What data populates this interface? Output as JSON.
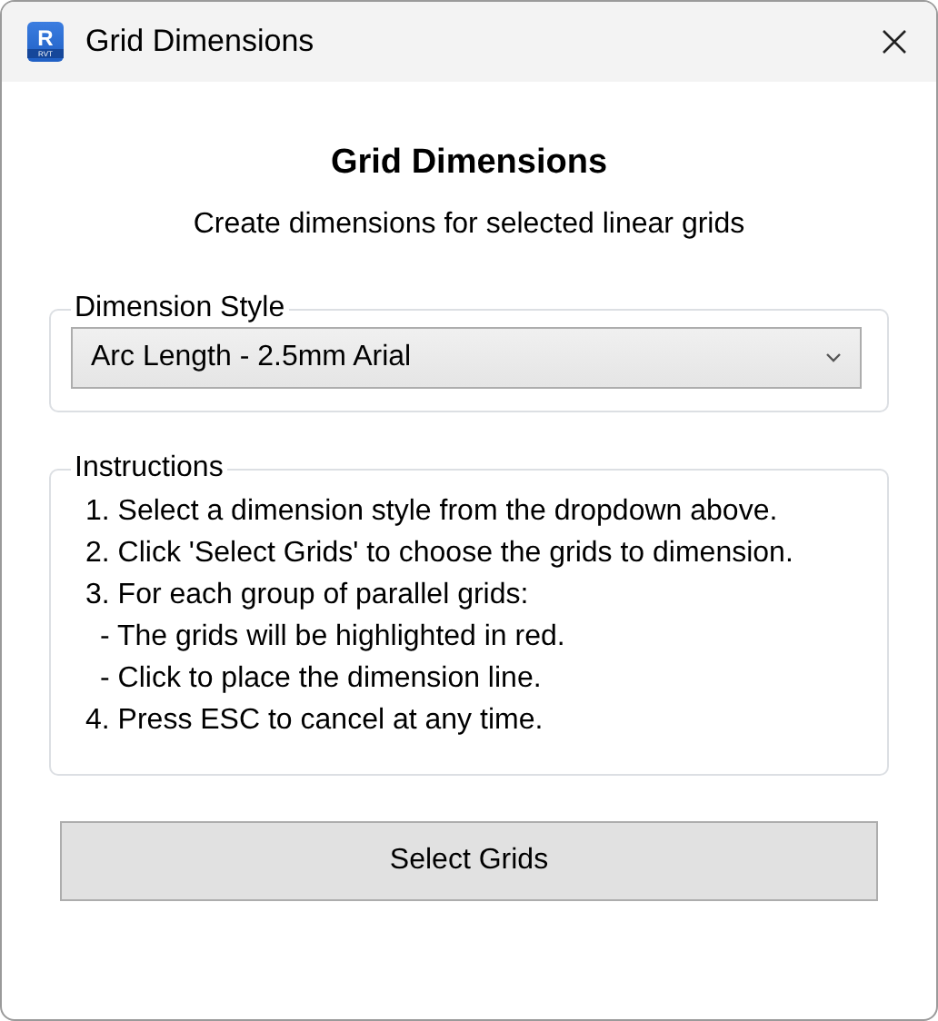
{
  "window": {
    "title": "Grid Dimensions",
    "app_icon": {
      "letter": "R",
      "caption": "RVT"
    }
  },
  "heading": "Grid Dimensions",
  "subtitle": "Create dimensions for selected linear grids",
  "dimension_style": {
    "legend": "Dimension Style",
    "value": "Arc Length - 2.5mm Arial"
  },
  "instructions": {
    "legend": "Instructions",
    "items": [
      {
        "text": "1. Select a dimension style from the dropdown above."
      },
      {
        "text": "2. Click 'Select Grids' to choose the grids to dimension."
      },
      {
        "text": "3. For each group of parallel grids:",
        "children": [
          {
            "text": "- The grids will be highlighted in red."
          },
          {
            "text": "- Click to place the dimension line."
          }
        ]
      },
      {
        "text": "4. Press ESC to cancel at any time."
      }
    ]
  },
  "buttons": [
    "Select Grids"
  ]
}
